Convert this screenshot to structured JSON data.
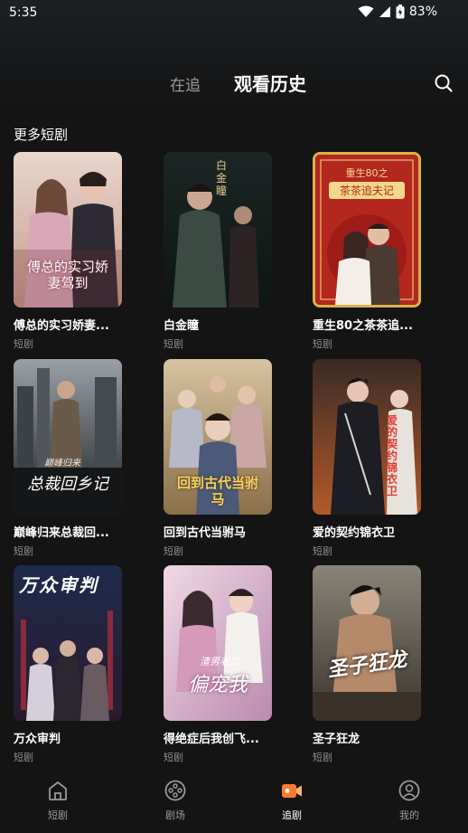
{
  "status": {
    "time": "5:35",
    "battery": "83%"
  },
  "header": {
    "tab_follow": "在追",
    "tab_history": "观看历史"
  },
  "section": {
    "title": "更多短剧"
  },
  "dramas": [
    {
      "title": "傅总的实习娇妻...",
      "tag": "短剧",
      "poster_text": "傅总的实习娇妻驾到"
    },
    {
      "title": "白金瞳",
      "tag": "短剧",
      "poster_text": "白金瞳"
    },
    {
      "title": "重生80之茶茶追...",
      "tag": "短剧",
      "poster_text": "重生80之",
      "poster_text2": "茶茶追夫记"
    },
    {
      "title": "巅峰归来总裁回...",
      "tag": "短剧",
      "poster_text": "总裁回乡记",
      "poster_text2": "巅峰归来"
    },
    {
      "title": "回到古代当驸马",
      "tag": "短剧",
      "poster_text": "回到古代当驸马"
    },
    {
      "title": "爱的契约锦衣卫",
      "tag": "短剧",
      "poster_text": "爱的契约锦衣卫"
    },
    {
      "title": "万众审判",
      "tag": "短剧",
      "poster_text": "万众审判"
    },
    {
      "title": "得绝症后我创飞...",
      "tag": "短剧",
      "poster_text": "偏宠我",
      "poster_text2": "渣男老公"
    },
    {
      "title": "圣子狂龙",
      "tag": "短剧",
      "poster_text": "圣子狂龙"
    }
  ],
  "nav": [
    {
      "label": "短剧",
      "icon": "home-icon"
    },
    {
      "label": "剧场",
      "icon": "film-reel-icon"
    },
    {
      "label": "追剧",
      "icon": "video-camera-icon",
      "active": true
    },
    {
      "label": "我的",
      "icon": "profile-icon"
    }
  ],
  "colors": {
    "background": "#141414",
    "accent": "#ff7a2e",
    "muted": "#8c8c8c"
  }
}
